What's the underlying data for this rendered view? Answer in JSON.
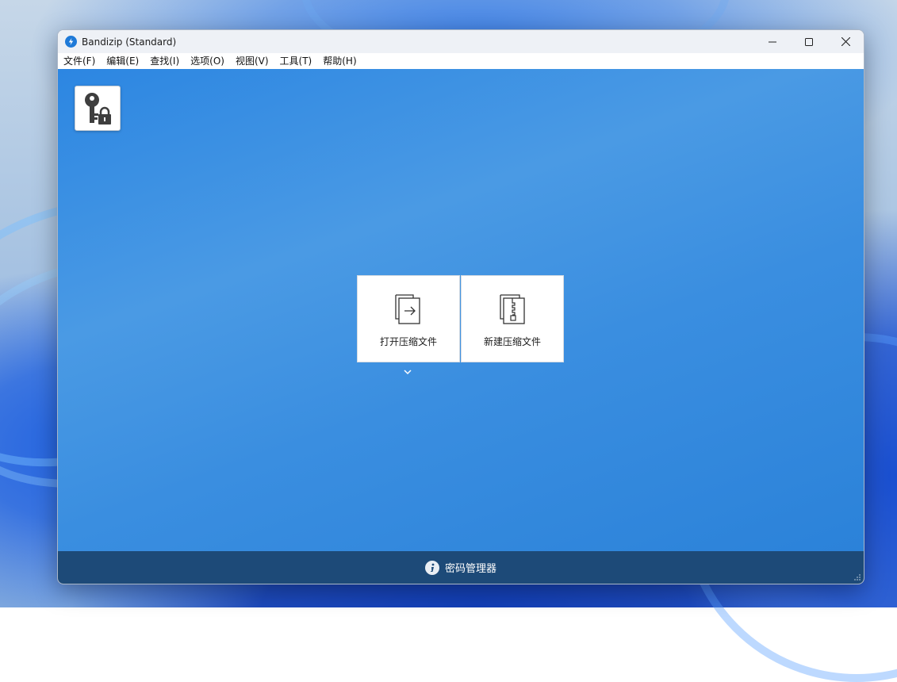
{
  "window": {
    "title": "Bandizip (Standard)"
  },
  "menu": [
    {
      "label": "文件(F)"
    },
    {
      "label": "编辑(E)"
    },
    {
      "label": "查找(I)"
    },
    {
      "label": "选项(O)"
    },
    {
      "label": "视图(V)"
    },
    {
      "label": "工具(T)"
    },
    {
      "label": "帮助(H)"
    }
  ],
  "main": {
    "tool_icon": "key-lock-icon",
    "tiles": [
      {
        "label": "打开压缩文件",
        "icon": "open-archive-icon"
      },
      {
        "label": "新建压缩文件",
        "icon": "new-archive-icon"
      }
    ]
  },
  "status": {
    "text": "密码管理器",
    "icon": "info-icon"
  },
  "colors": {
    "main_background": "#3a8ee0",
    "status_bar": "#1d4a78",
    "titlebar": "#eef1f6",
    "app_icon": "#1f7ad8"
  }
}
